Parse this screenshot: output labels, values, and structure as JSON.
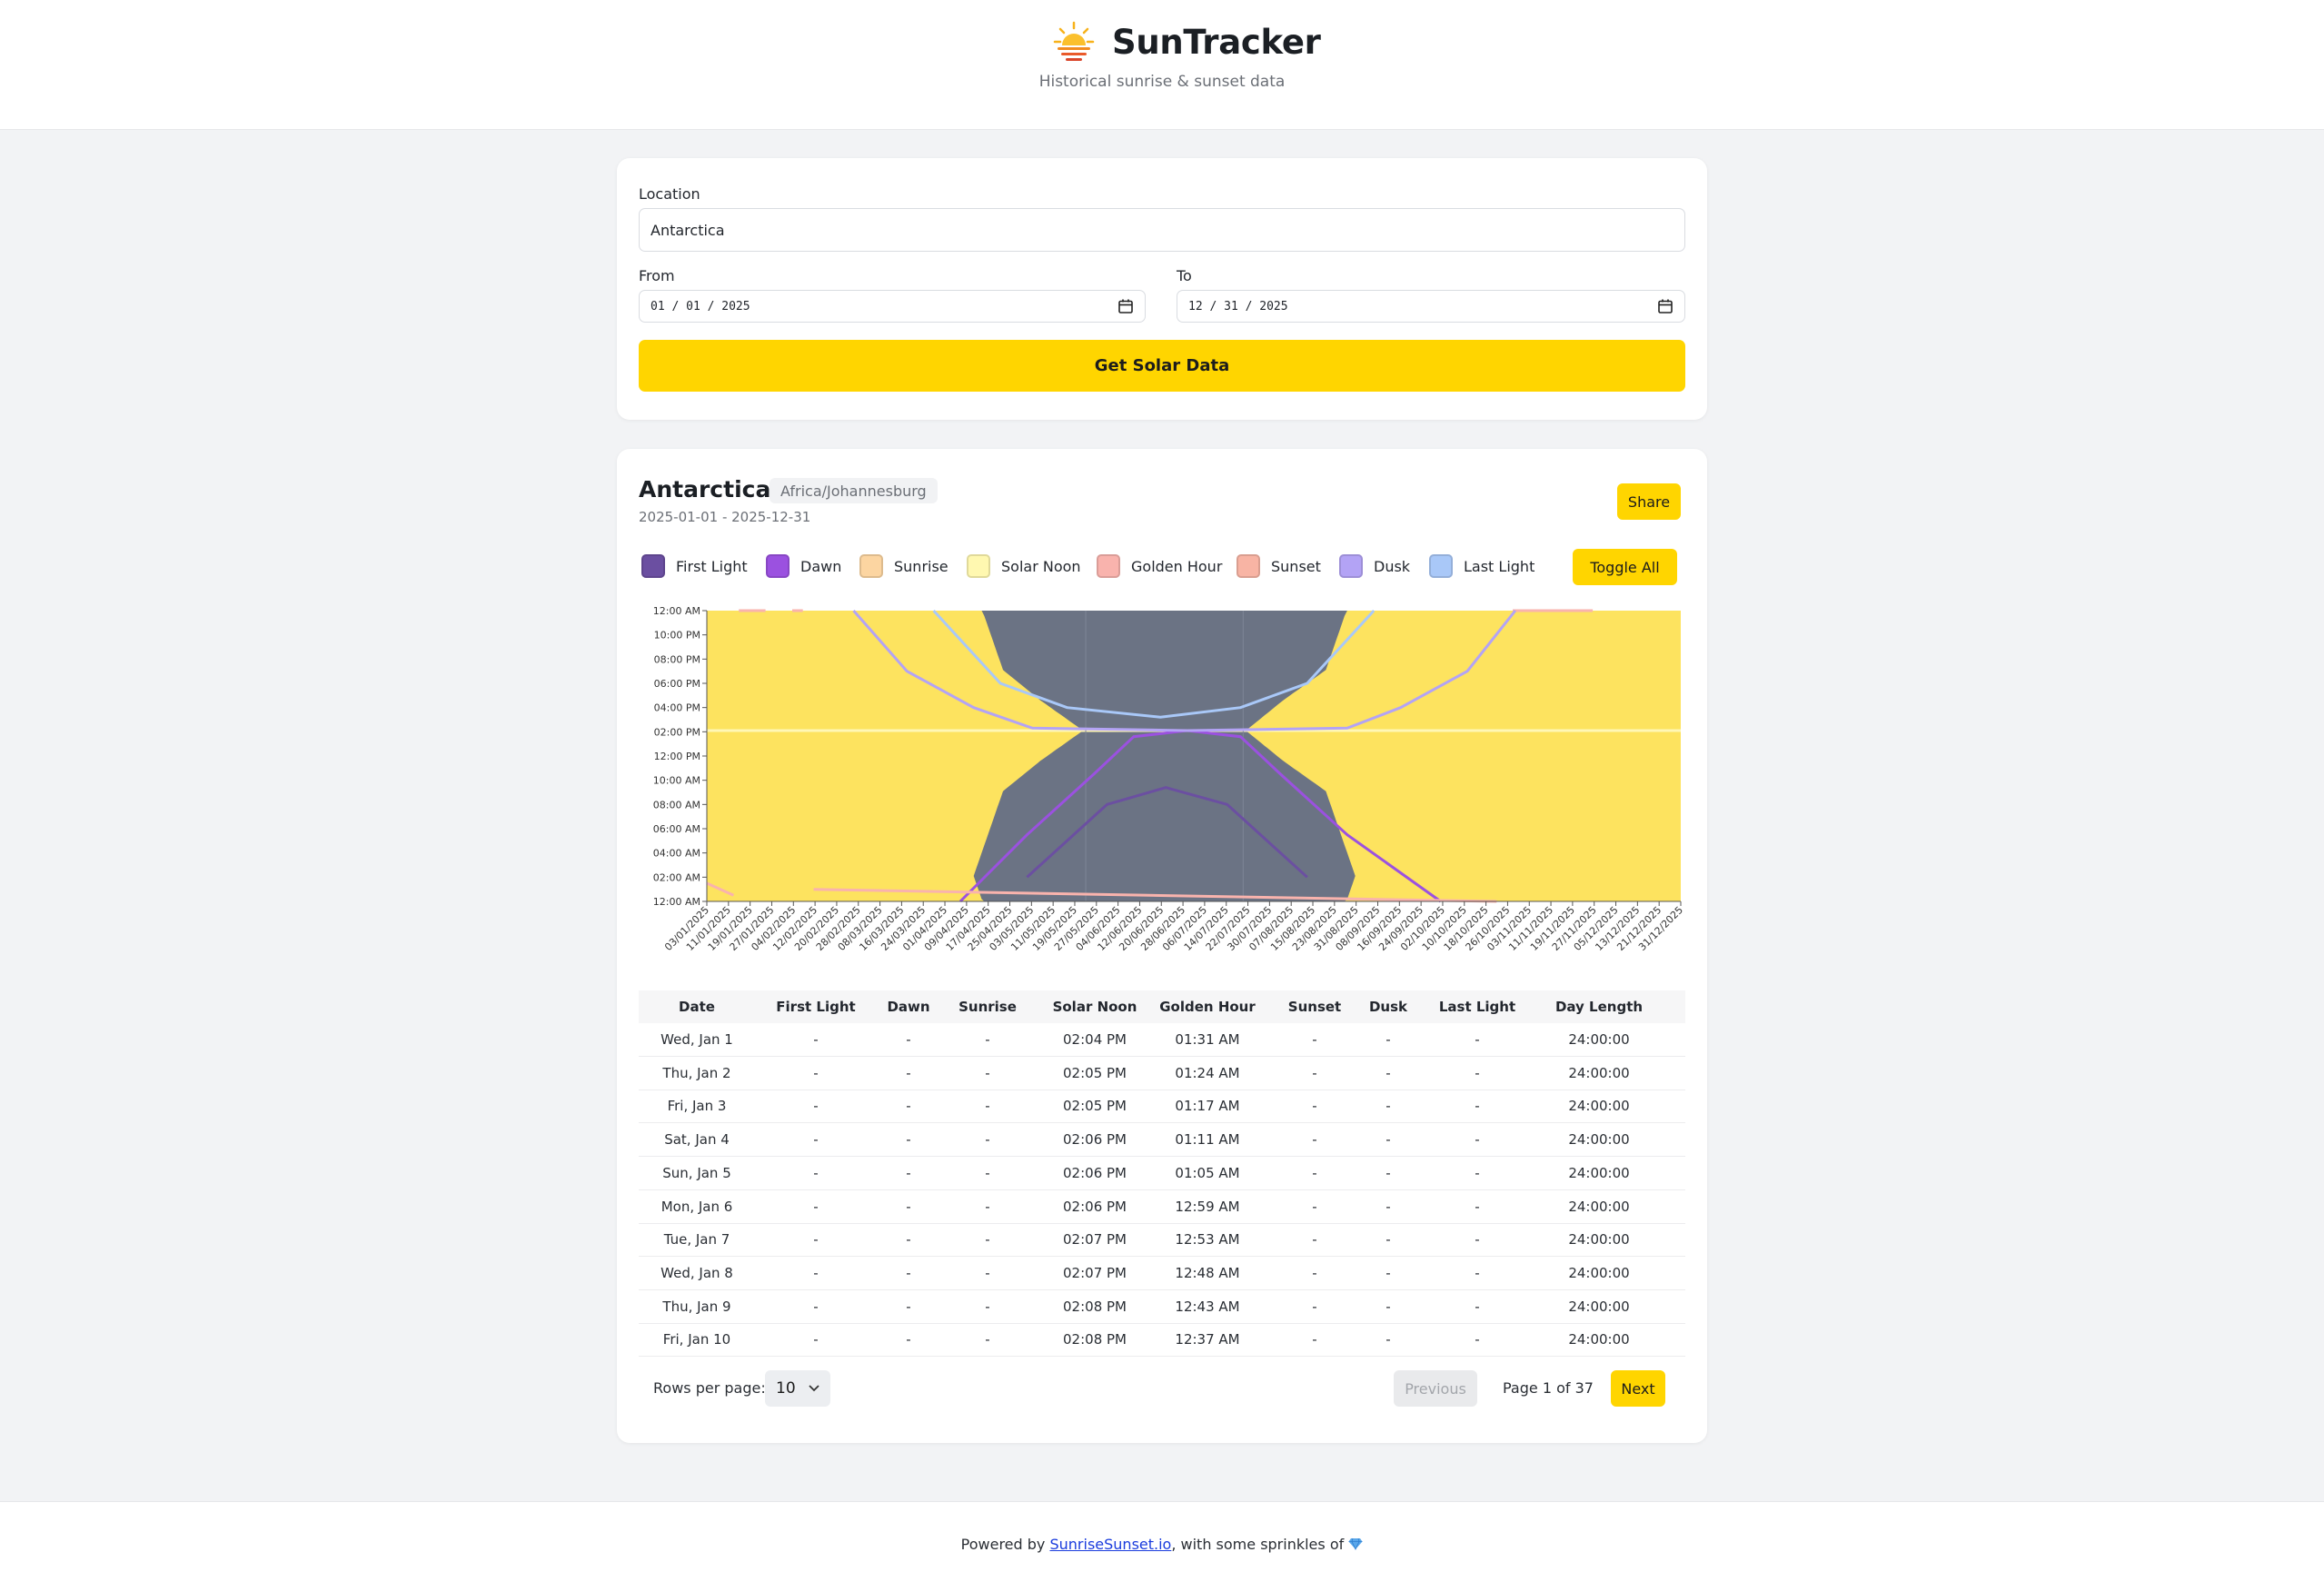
{
  "app": {
    "title": "SunTracker",
    "subtitle": "Historical sunrise & sunset data",
    "logo_icon": "sun-logo-icon"
  },
  "form": {
    "location_label": "Location",
    "location_value": "Antarctica",
    "from_label": "From",
    "from_value": "01 / 01 / 2025",
    "to_label": "To",
    "to_value": "12 / 31 / 2025",
    "submit_label": "Get Solar Data"
  },
  "results": {
    "location": "Antarctica",
    "timezone": "Africa/Johannesburg",
    "range": "2025-01-01 - 2025-12-31",
    "share_label": "Share",
    "toggle_label": "Toggle All"
  },
  "legend": [
    {
      "label": "First Light",
      "color": "#6b4fa1"
    },
    {
      "label": "Dawn",
      "color": "#9b51e0"
    },
    {
      "label": "Sunrise",
      "color": "#fcd5a1"
    },
    {
      "label": "Solar Noon",
      "color": "#fff8b0"
    },
    {
      "label": "Golden Hour",
      "color": "#f9b3ad"
    },
    {
      "label": "Sunset",
      "color": "#f8b4a4"
    },
    {
      "label": "Dusk",
      "color": "#b3a3f5"
    },
    {
      "label": "Last Light",
      "color": "#a9c8f8"
    }
  ],
  "chart_data": {
    "type": "area",
    "y_tick_labels": [
      "12:00 AM",
      "10:00 PM",
      "08:00 PM",
      "06:00 PM",
      "04:00 PM",
      "02:00 PM",
      "12:00 PM",
      "10:00 AM",
      "08:00 AM",
      "06:00 AM",
      "04:00 AM",
      "02:00 AM",
      "12:00 AM"
    ],
    "x_tick_labels": [
      "03/01/2025",
      "11/01/2025",
      "19/01/2025",
      "27/01/2025",
      "04/02/2025",
      "12/02/2025",
      "20/02/2025",
      "28/02/2025",
      "08/03/2025",
      "16/03/2025",
      "24/03/2025",
      "01/04/2025",
      "09/04/2025",
      "17/04/2025",
      "25/04/2025",
      "03/05/2025",
      "11/05/2025",
      "19/05/2025",
      "27/05/2025",
      "04/06/2025",
      "12/06/2025",
      "20/06/2025",
      "28/06/2025",
      "06/07/2025",
      "14/07/2025",
      "22/07/2025",
      "30/07/2025",
      "07/08/2025",
      "15/08/2025",
      "23/08/2025",
      "31/08/2025",
      "08/09/2025",
      "16/09/2025",
      "24/09/2025",
      "02/10/2025",
      "10/10/2025",
      "18/10/2025",
      "26/10/2025",
      "03/11/2025",
      "11/11/2025",
      "19/11/2025",
      "27/11/2025",
      "05/12/2025",
      "13/12/2025",
      "21/12/2025",
      "31/12/2025"
    ],
    "day_color": "#fde35f",
    "night_color": "#6b7384",
    "solar_noon_hour": 14.1,
    "polar_night": {
      "start_day": 142,
      "end_day": 201
    },
    "daylight_hours_by_day": [
      [
        0,
        24
      ],
      [
        100,
        24
      ],
      [
        111,
        10
      ],
      [
        125,
        5
      ],
      [
        141,
        0
      ],
      [
        202,
        0
      ],
      [
        216,
        5
      ],
      [
        232,
        10
      ],
      [
        243,
        24
      ],
      [
        365,
        24
      ]
    ],
    "series": [
      {
        "name": "First Light",
        "color": "#6b4fa1",
        "points": [
          [
            120,
            2
          ],
          [
            150,
            8
          ],
          [
            172,
            9.4
          ],
          [
            195,
            8
          ],
          [
            225,
            2
          ]
        ]
      },
      {
        "name": "Dawn",
        "color": "#9b51e0",
        "points": [
          [
            95,
            0
          ],
          [
            120,
            5.5
          ],
          [
            145,
            10.5
          ],
          [
            160,
            13.6
          ],
          [
            180,
            14.1
          ],
          [
            200,
            13.6
          ],
          [
            215,
            10.5
          ],
          [
            240,
            5.5
          ],
          [
            275,
            0
          ]
        ]
      },
      {
        "name": "Golden Hour",
        "color": "#f9b3ad",
        "points": [
          [
            0,
            1.5
          ],
          [
            10,
            0.5
          ],
          [
            12,
            24
          ],
          [
            22,
            24
          ],
          [
            24,
            0
          ],
          [
            32,
            24
          ],
          [
            36,
            24
          ],
          [
            40,
            1
          ],
          [
            296,
            0
          ],
          [
            302,
            24
          ],
          [
            318,
            24
          ],
          [
            332,
            24
          ],
          [
            355,
            1
          ]
        ]
      },
      {
        "name": "Dusk",
        "color": "#b3a3f5",
        "points": [
          [
            55,
            24
          ],
          [
            75,
            19
          ],
          [
            100,
            16
          ],
          [
            122,
            14.3
          ],
          [
            180,
            14.1
          ],
          [
            240,
            14.3
          ],
          [
            260,
            16
          ],
          [
            285,
            19
          ],
          [
            303,
            24
          ]
        ]
      },
      {
        "name": "Last Light",
        "color": "#a9c8f8",
        "points": [
          [
            85,
            24
          ],
          [
            110,
            18
          ],
          [
            135,
            16
          ],
          [
            170,
            15.2
          ],
          [
            200,
            16
          ],
          [
            225,
            18
          ],
          [
            250,
            24
          ]
        ]
      }
    ]
  },
  "table": {
    "columns": [
      "Date",
      "First Light",
      "Dawn",
      "Sunrise",
      "Solar Noon",
      "Golden Hour",
      "Sunset",
      "Dusk",
      "Last Light",
      "Day Length"
    ],
    "rows": [
      [
        "Wed, Jan 1",
        "-",
        "-",
        "-",
        "02:04 PM",
        "01:31 AM",
        "-",
        "-",
        "-",
        "24:00:00"
      ],
      [
        "Thu, Jan 2",
        "-",
        "-",
        "-",
        "02:05 PM",
        "01:24 AM",
        "-",
        "-",
        "-",
        "24:00:00"
      ],
      [
        "Fri, Jan 3",
        "-",
        "-",
        "-",
        "02:05 PM",
        "01:17 AM",
        "-",
        "-",
        "-",
        "24:00:00"
      ],
      [
        "Sat, Jan 4",
        "-",
        "-",
        "-",
        "02:06 PM",
        "01:11 AM",
        "-",
        "-",
        "-",
        "24:00:00"
      ],
      [
        "Sun, Jan 5",
        "-",
        "-",
        "-",
        "02:06 PM",
        "01:05 AM",
        "-",
        "-",
        "-",
        "24:00:00"
      ],
      [
        "Mon, Jan 6",
        "-",
        "-",
        "-",
        "02:06 PM",
        "12:59 AM",
        "-",
        "-",
        "-",
        "24:00:00"
      ],
      [
        "Tue, Jan 7",
        "-",
        "-",
        "-",
        "02:07 PM",
        "12:53 AM",
        "-",
        "-",
        "-",
        "24:00:00"
      ],
      [
        "Wed, Jan 8",
        "-",
        "-",
        "-",
        "02:07 PM",
        "12:48 AM",
        "-",
        "-",
        "-",
        "24:00:00"
      ],
      [
        "Thu, Jan 9",
        "-",
        "-",
        "-",
        "02:08 PM",
        "12:43 AM",
        "-",
        "-",
        "-",
        "24:00:00"
      ],
      [
        "Fri, Jan 10",
        "-",
        "-",
        "-",
        "02:08 PM",
        "12:37 AM",
        "-",
        "-",
        "-",
        "24:00:00"
      ]
    ]
  },
  "pagination": {
    "rows_per_page_label": "Rows per page:",
    "rows_per_page_value": "10",
    "previous_label": "Previous",
    "page_info": "Page 1 of 37",
    "next_label": "Next"
  },
  "footer": {
    "prefix": "Powered by ",
    "link_text": "SunriseSunset.io",
    "suffix": ", with some sprinkles of ",
    "icon": "gem-icon"
  }
}
